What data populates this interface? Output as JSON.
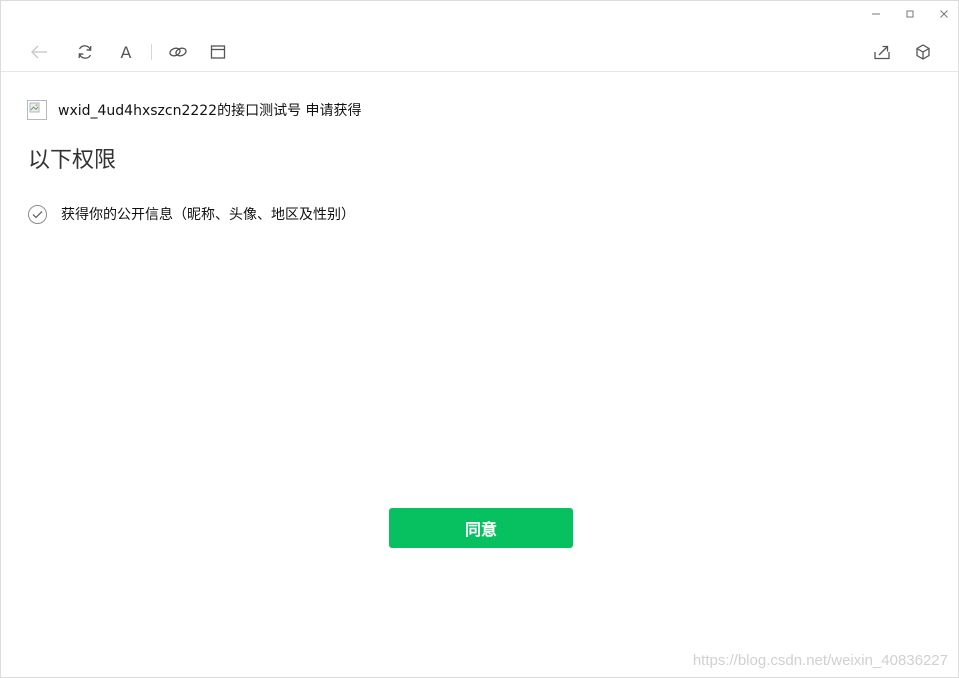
{
  "window_controls": {
    "minimize_icon": "minimize-icon",
    "maximize_icon": "maximize-icon",
    "close_icon": "close-icon"
  },
  "toolbar": {
    "back_icon": "back-arrow-icon",
    "refresh_icon": "refresh-icon",
    "font_label": "A",
    "link_icon": "link-icon",
    "window_icon": "window-icon",
    "share_icon": "share-icon",
    "cube_icon": "cube-icon"
  },
  "auth": {
    "app_text": "wxid_4ud4hxszcn2222的接口测试号 申请获得",
    "permission_title": "以下权限",
    "permissions": [
      {
        "label": "获得你的公开信息（昵称、头像、地区及性别）",
        "checked": true
      }
    ],
    "agree_label": "同意"
  },
  "colors": {
    "accent": "#07c160"
  },
  "watermark": "https://blog.csdn.net/weixin_40836227"
}
